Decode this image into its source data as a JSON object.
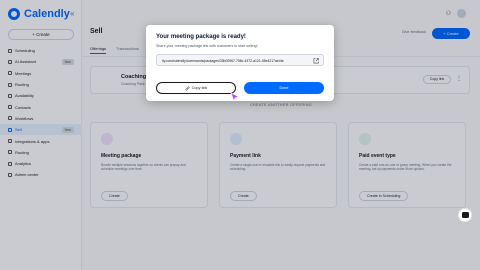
{
  "app": {
    "logo_text": "Calendly",
    "collapse_icon": "double-chevron-left-icon",
    "create_label": "+ Create",
    "sidebar": {
      "items": [
        {
          "label": "Scheduling",
          "icon": "link-icon",
          "active": false,
          "badge": ""
        },
        {
          "label": "AI Assistant",
          "icon": "sparkle-icon",
          "active": false,
          "badge": "New"
        },
        {
          "label": "Meetings",
          "icon": "calendar-icon",
          "active": false,
          "badge": ""
        },
        {
          "label": "Routing",
          "icon": "routing-icon",
          "active": false,
          "badge": ""
        },
        {
          "label": "Availability",
          "icon": "clock-icon",
          "active": false,
          "badge": ""
        },
        {
          "label": "Contacts",
          "icon": "contacts-icon",
          "active": false,
          "badge": ""
        },
        {
          "label": "Workflows",
          "icon": "workflow-icon",
          "active": false,
          "badge": ""
        },
        {
          "label": "Sell",
          "icon": "tag-icon",
          "active": true,
          "badge": "New"
        },
        {
          "label": "Integrations & apps",
          "icon": "grid-icon",
          "active": false,
          "badge": ""
        },
        {
          "label": "Routing",
          "icon": "routing-icon",
          "active": false,
          "badge": ""
        },
        {
          "label": "Analytics",
          "icon": "chart-icon",
          "active": false,
          "badge": ""
        },
        {
          "label": "Admin center",
          "icon": "admin-icon",
          "active": false,
          "badge": ""
        }
      ]
    },
    "page_title": "Sell",
    "header_link": "Give feedback",
    "header_button": "+ Create",
    "tabs": [
      "Offerings",
      "Transactions"
    ],
    "coach_card": {
      "title": "Coaching Session",
      "subtitle": "Coaching Pack...",
      "copy_label": "Copy link"
    },
    "section_label": "CREATE ANOTHER OFFERING",
    "options": [
      {
        "title": "Meeting package",
        "desc": "Bundle multiple sessions together so clients can prepay and schedule meetings over time.",
        "button": "Create",
        "color": "#f4e3ff"
      },
      {
        "title": "Payment link",
        "desc": "Create a single-use or reusable link to easily request payments and scheduling.",
        "button": "Create",
        "color": "#e3f0ff"
      },
      {
        "title": "Paid event type",
        "desc": "Create a paid one-on-one or group meeting. When you create the meeting, set up payments under More options.",
        "button": "Create in Scheduling",
        "color": "#e2f7ef"
      }
    ]
  },
  "modal": {
    "title": "Your meeting package is ready!",
    "description": "Share your meeting package link with customers to start selling!",
    "link": "tly.com/calendly/commands/packages/33b00967-798c-4372-a121-55e4217ae4fa",
    "copy_label": "Copy link",
    "done_label": "Done"
  },
  "colors": {
    "accent": "#006bff"
  }
}
